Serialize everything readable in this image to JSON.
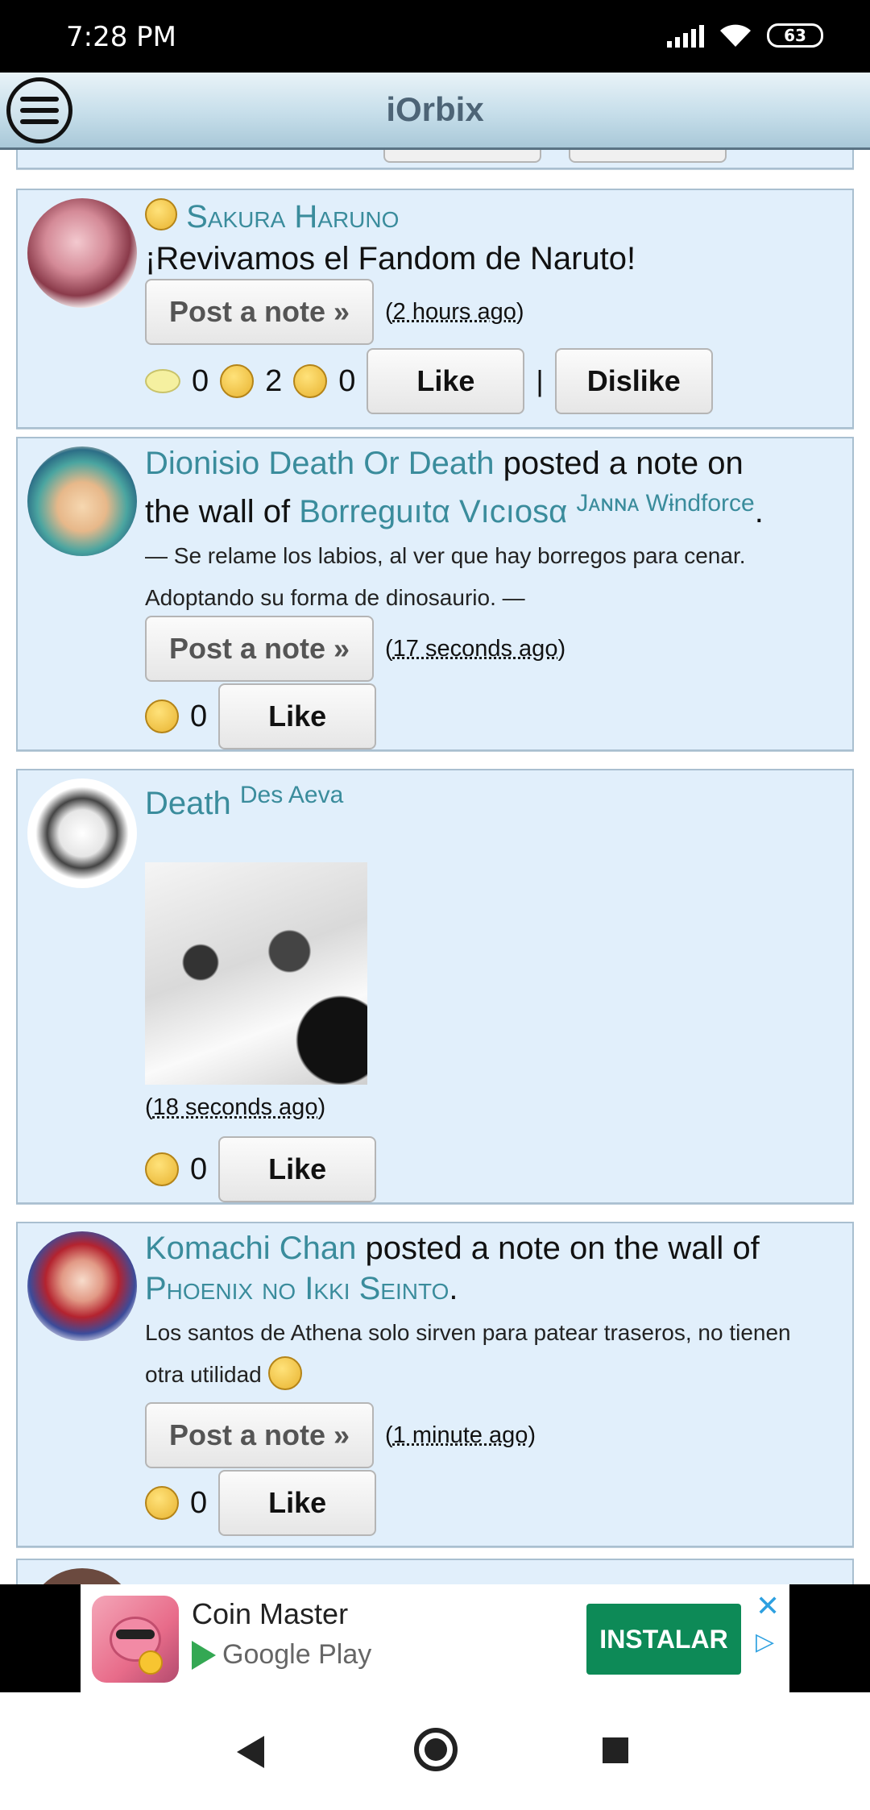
{
  "status": {
    "time": "7:28 PM",
    "battery": "63"
  },
  "header": {
    "title": "iOrbix"
  },
  "posts": [
    {
      "author": "Sakura Haruno",
      "text": "¡Revivamos el Fandom de Naruto!",
      "post_label": "Post a note »",
      "time": "2 hours ago",
      "counts": {
        "comments": "0",
        "likes": "2",
        "dislikes": "0"
      },
      "like_label": "Like",
      "separator": "|",
      "dislike_label": "Dislike"
    },
    {
      "author": "Dionisio Death Or Death",
      "action": "posted a note on",
      "action2": "the wall of",
      "target": "Borreguıtα Vıcıosα",
      "target_tag": "Jᴀɴɴᴀ Wɨndforce",
      "end": ".",
      "body1": "— Se relame los labios, al ver que hay borregos para cenar.",
      "body2": "Adoptando su forma de dinosaurio. —",
      "post_label": "Post a note »",
      "time": "17 seconds ago",
      "count": "0",
      "like_label": "Like"
    },
    {
      "author": "Death",
      "author_tag": "Des Aeva",
      "time": "18 seconds ago",
      "count": "0",
      "like_label": "Like"
    },
    {
      "author": "Komachi Chan",
      "action": "posted a note on the wall of",
      "target": "Phoenix no Ikki Seinto",
      "end": ".",
      "body1": "Los santos de Athena solo sirven para patear traseros, no tienen",
      "body2": "otra utilidad",
      "post_label": "Post a note »",
      "time": "1 minute ago",
      "count": "0",
      "like_label": "Like"
    }
  ],
  "ad": {
    "title": "Coin Master",
    "store": "Google Play",
    "cta": "INSTALAR",
    "close": "✕",
    "choice": "▷"
  },
  "paren_open": "(",
  "paren_close": ")"
}
